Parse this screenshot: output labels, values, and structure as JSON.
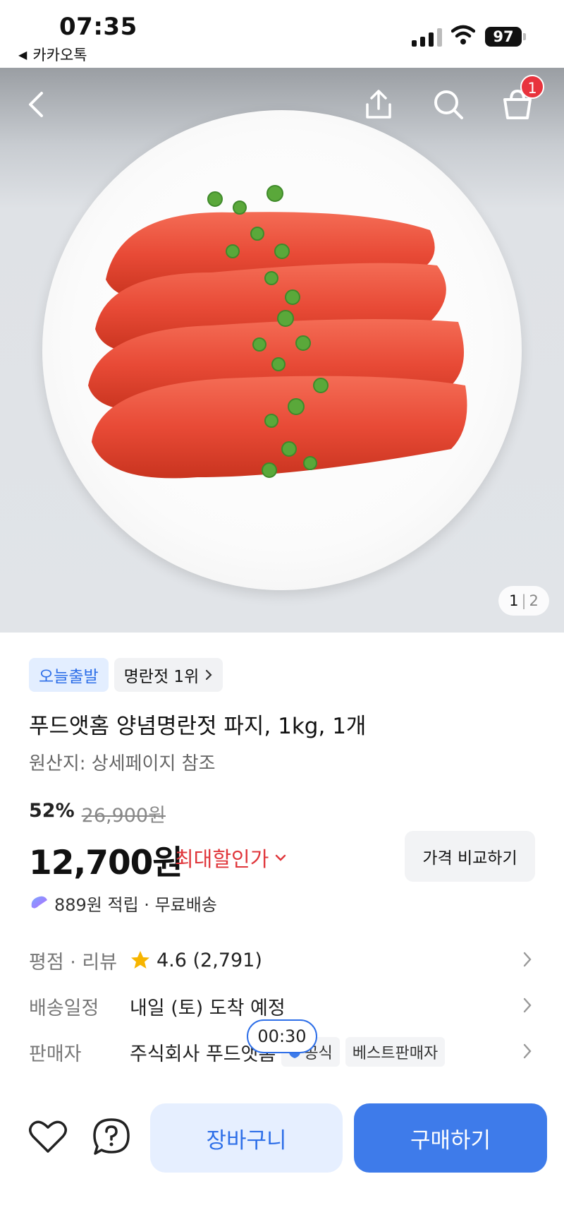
{
  "status_bar": {
    "time": "07:35",
    "back_app_label": "카카오톡",
    "battery": "97"
  },
  "header": {
    "cart_count": "1",
    "icons": [
      "back-icon",
      "share-icon",
      "search-icon",
      "cart-icon"
    ]
  },
  "gallery": {
    "current": "1",
    "separator": "|",
    "total": "2"
  },
  "product": {
    "badge_today": "오늘출발",
    "badge_rank": "명란젓 1위",
    "title": "푸드앳홈 양념명란젓 파지, 1kg, 1개",
    "origin": "원산지: 상세페이지 참조",
    "discount_pct": "52%",
    "original_price": "26,900원",
    "price": "12,700원",
    "max_discount_label": "최대할인가",
    "compare_label": "가격 비교하기",
    "reward_text": "889원 적립 · 무료배송"
  },
  "info": {
    "rating_label": "평점 · 리뷰",
    "rating_value": "4.6 (2,791)",
    "delivery_label": "배송일정",
    "delivery_value": "내일 (토) 도착 예정",
    "seller_label": "판매자",
    "seller_value": "주식회사 푸드앳홈",
    "seller_tag_official": "공식",
    "seller_tag_best": "베스트판매자",
    "timer": "00:30"
  },
  "bottom_bar": {
    "cart_label": "장바구니",
    "buy_label": "구매하기"
  },
  "colors": {
    "accent": "#3e7bea",
    "discount_red": "#e0363b",
    "badge_red": "#e8333d"
  }
}
